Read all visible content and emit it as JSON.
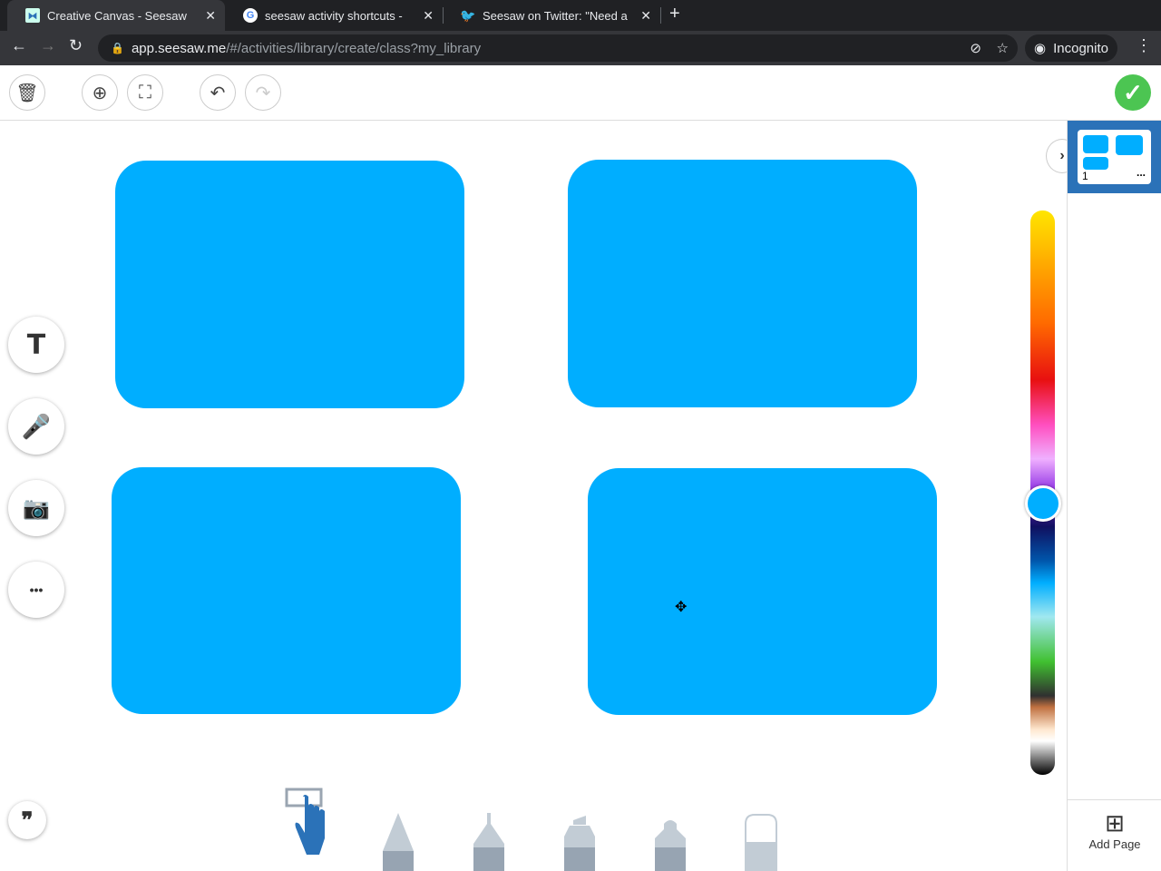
{
  "browser": {
    "tabs": [
      {
        "title": "Creative Canvas - Seesaw",
        "active": true
      },
      {
        "title": "seesaw activity shortcuts -"
      },
      {
        "title": "Seesaw on Twitter: \"Need a"
      }
    ],
    "url_host": "app.seesaw.me",
    "url_path": "/#/activities/library/create/class?my_library",
    "incognito_label": "Incognito"
  },
  "canvas": {
    "shape_color": "#00aeff",
    "selected_color": "#00aeff"
  },
  "pages": {
    "current_page_number": "1",
    "more_label": "...",
    "add_page_label": "Add Page"
  },
  "icons": {
    "done": "✓",
    "text": "T",
    "more": "•••",
    "quote": "❞",
    "expand": "›"
  }
}
